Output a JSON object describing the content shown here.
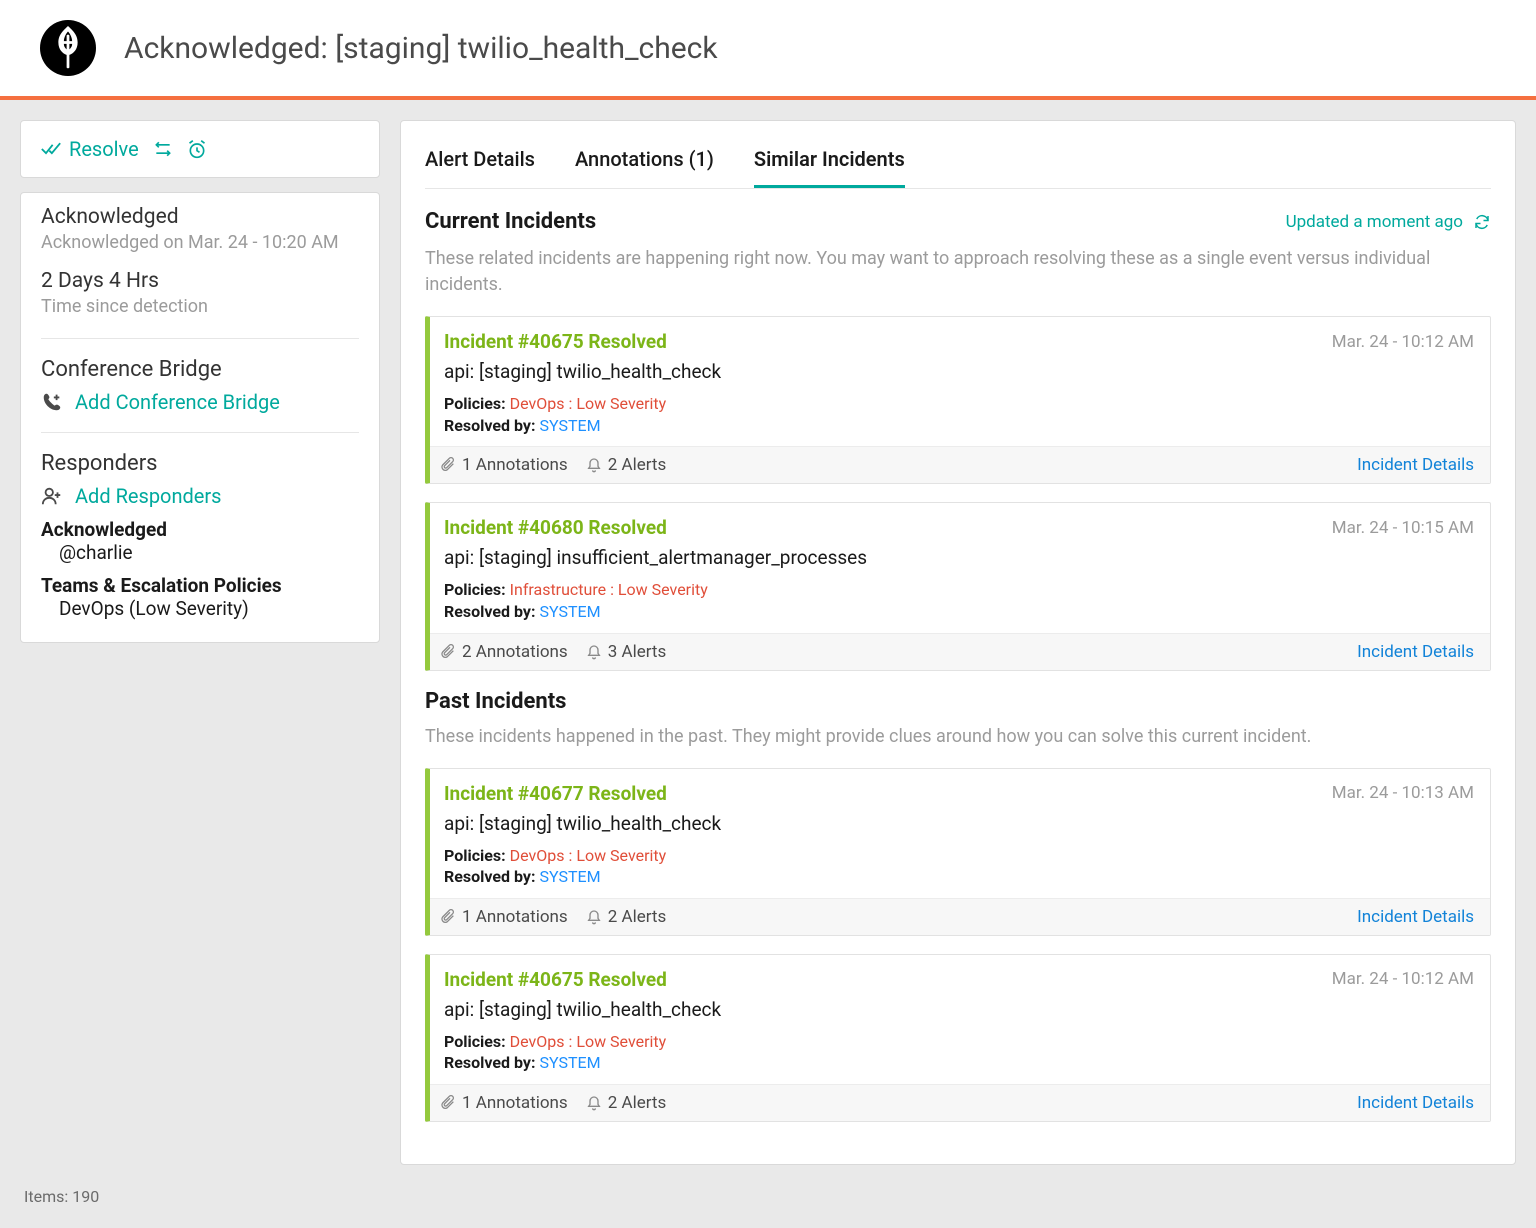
{
  "header": {
    "title": "Acknowledged: [staging] twilio_health_check"
  },
  "sidebar": {
    "resolve_label": "Resolve",
    "ack": {
      "title": "Acknowledged",
      "subtitle": "Acknowledged on Mar. 24 - 10:20 AM"
    },
    "duration": {
      "title": "2 Days 4 Hrs",
      "subtitle": "Time since detection"
    },
    "conference": {
      "heading": "Conference Bridge",
      "action": "Add Conference Bridge"
    },
    "responders": {
      "heading": "Responders",
      "action": "Add Responders",
      "ack_label": "Acknowledged",
      "user": "@charlie",
      "teams_label": "Teams & Escalation Policies",
      "teams_value": "DevOps (Low Severity)"
    }
  },
  "tabs": [
    {
      "label": "Alert Details",
      "active": false
    },
    {
      "label": "Annotations (1)",
      "active": false
    },
    {
      "label": "Similar Incidents",
      "active": true
    }
  ],
  "current": {
    "heading": "Current Incidents",
    "updated": "Updated a moment ago",
    "description": "These related incidents are happening right now. You may want to approach resolving these as a single event versus individual incidents.",
    "incidents": [
      {
        "title": "Incident #40675 Resolved",
        "time": "Mar. 24 - 10:12 AM",
        "source": "api: [staging] twilio_health_check",
        "policies_label": "Policies:",
        "policies_value": "DevOps : Low Severity",
        "resolved_label": "Resolved by:",
        "resolved_value": "SYSTEM",
        "annotations": "1 Annotations",
        "alerts": "2 Alerts",
        "details": "Incident Details"
      },
      {
        "title": "Incident #40680 Resolved",
        "time": "Mar. 24 - 10:15 AM",
        "source": "api: [staging] insufficient_alertmanager_processes",
        "policies_label": "Policies:",
        "policies_value": "Infrastructure : Low Severity",
        "resolved_label": "Resolved by:",
        "resolved_value": "SYSTEM",
        "annotations": "2 Annotations",
        "alerts": "3 Alerts",
        "details": "Incident Details"
      }
    ]
  },
  "past": {
    "heading": "Past Incidents",
    "description": "These incidents happened in the past. They might provide clues around how you can solve this current incident.",
    "incidents": [
      {
        "title": "Incident #40677 Resolved",
        "time": "Mar. 24 - 10:13 AM",
        "source": "api: [staging] twilio_health_check",
        "policies_label": "Policies:",
        "policies_value": "DevOps : Low Severity",
        "resolved_label": "Resolved by:",
        "resolved_value": "SYSTEM",
        "annotations": "1 Annotations",
        "alerts": "2 Alerts",
        "details": "Incident Details"
      },
      {
        "title": "Incident #40675 Resolved",
        "time": "Mar. 24 - 10:12 AM",
        "source": "api: [staging] twilio_health_check",
        "policies_label": "Policies:",
        "policies_value": "DevOps : Low Severity",
        "resolved_label": "Resolved by:",
        "resolved_value": "SYSTEM",
        "annotations": "1 Annotations",
        "alerts": "2 Alerts",
        "details": "Incident Details"
      }
    ]
  },
  "footer": {
    "items": "Items: 190"
  }
}
